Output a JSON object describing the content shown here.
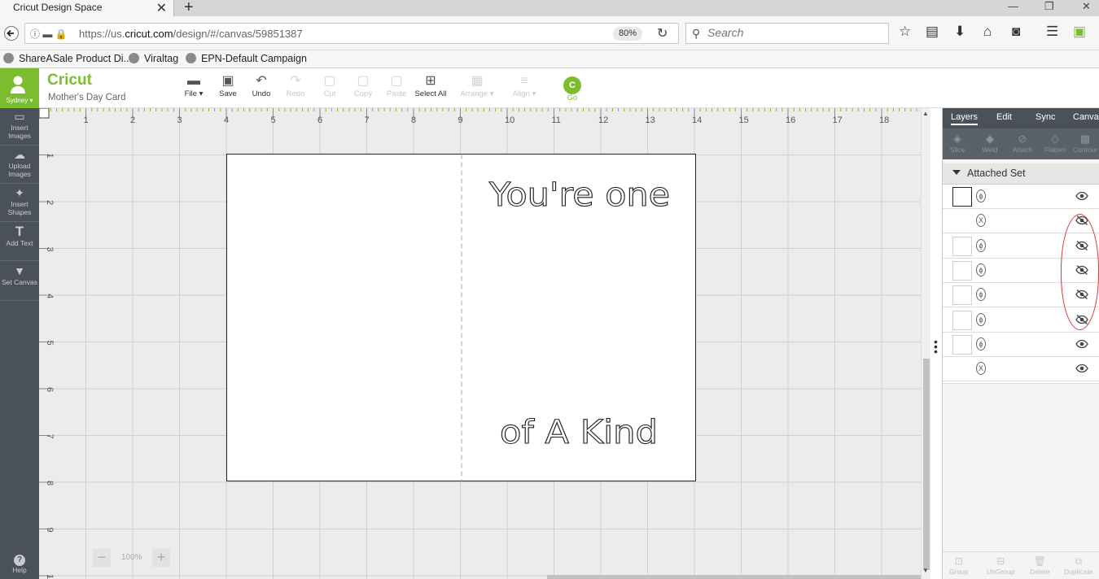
{
  "browser": {
    "tab_title": "Cricut Design Space",
    "tab_close": "✕",
    "new_tab": "+",
    "window_controls": [
      "—",
      "❐",
      "✕"
    ],
    "url_prefix": "https://us.",
    "url_host": "cricut.com",
    "url_path": "/design/#/canvas/59851387",
    "zoom": "80%",
    "search_placeholder": "Search",
    "bookmarks": [
      "ShareASale Product Di...",
      "Viraltag",
      "EPN-Default Campaign"
    ]
  },
  "app": {
    "logo": "Cricut",
    "project_name": "Mother's Day Card",
    "user_name": "Sydney ▾",
    "toolbar": [
      {
        "label": "File ▾",
        "icon": "folder-icon",
        "glyph": "▬",
        "enabled": true
      },
      {
        "label": "Save",
        "icon": "save-icon",
        "glyph": "▣",
        "enabled": true
      },
      {
        "label": "Undo",
        "icon": "undo-icon",
        "glyph": "↶",
        "enabled": true
      },
      {
        "label": "Redo",
        "icon": "redo-icon",
        "glyph": "↷",
        "enabled": false
      },
      {
        "label": "Cut",
        "icon": "cut-icon",
        "glyph": "▢",
        "enabled": false
      },
      {
        "label": "Copy",
        "icon": "copy-icon",
        "glyph": "▢",
        "enabled": false
      },
      {
        "label": "Paste",
        "icon": "paste-icon",
        "glyph": "▢",
        "enabled": false
      },
      {
        "label": "Select All",
        "icon": "select-all-icon",
        "glyph": "⊞",
        "enabled": true
      },
      {
        "label": "Arrange ▾",
        "icon": "arrange-icon",
        "glyph": "▦",
        "enabled": false
      },
      {
        "label": "Align ▾",
        "icon": "align-icon",
        "glyph": "≡",
        "enabled": false
      }
    ],
    "go_badge": "C",
    "go_label": "Go"
  },
  "sidebar": {
    "items": [
      {
        "label": "Insert Images",
        "icon": "image-icon",
        "glyph": "▭"
      },
      {
        "label": "Upload Images",
        "icon": "upload-cloud-icon",
        "glyph": "☁"
      },
      {
        "label": "Insert Shapes",
        "icon": "shapes-icon",
        "glyph": "✦"
      },
      {
        "label": "Add Text",
        "icon": "text-icon",
        "glyph": "T"
      },
      {
        "label": "Set Canvas",
        "icon": "shirt-icon",
        "glyph": "▼"
      }
    ],
    "help": "Help",
    "help_glyph": "?"
  },
  "canvas": {
    "ruler_h": [
      "1",
      "2",
      "3",
      "4",
      "5",
      "6",
      "7",
      "8",
      "9",
      "10",
      "11",
      "12",
      "13",
      "14",
      "15",
      "16",
      "17",
      "18"
    ],
    "ruler_v": [
      "1",
      "2",
      "3",
      "4",
      "5",
      "6",
      "7",
      "8",
      "9",
      "10"
    ],
    "card_text_top": "You're one",
    "card_text_bottom": "of A Kind",
    "zoom_minus": "−",
    "zoom_value": "100%",
    "zoom_plus": "+"
  },
  "panel": {
    "tabs": [
      "Layers",
      "Edit",
      "Sync",
      "Canvas"
    ],
    "active_tab": "Layers",
    "tools": [
      {
        "label": "Slice",
        "glyph": "◈"
      },
      {
        "label": "Weld",
        "glyph": "◆"
      },
      {
        "label": "Attach",
        "glyph": "⊘"
      },
      {
        "label": "Flatten",
        "glyph": "◇"
      },
      {
        "label": "Contour",
        "glyph": "▩"
      }
    ],
    "group_label": "Attached Set",
    "layers": [
      {
        "op": "cut",
        "op_glyph": "ϕ",
        "visible": true
      },
      {
        "op": "score",
        "op_glyph": "X",
        "visible": false
      },
      {
        "op": "cut",
        "op_glyph": "ϕ",
        "visible": false
      },
      {
        "op": "cut",
        "op_glyph": "ϕ",
        "visible": false
      },
      {
        "op": "cut",
        "op_glyph": "ϕ",
        "visible": false
      },
      {
        "op": "cut",
        "op_glyph": "ϕ",
        "visible": false
      },
      {
        "op": "cut",
        "op_glyph": "ϕ",
        "visible": true
      },
      {
        "op": "score",
        "op_glyph": "X",
        "visible": true
      }
    ],
    "bottom_tools": [
      {
        "label": "Group",
        "glyph": "⊡"
      },
      {
        "label": "UnGroup",
        "glyph": "⊟"
      },
      {
        "label": "Delete",
        "glyph": "🗑"
      },
      {
        "label": "Duplicate",
        "glyph": "⧉"
      }
    ]
  },
  "colors": {
    "brand_green": "#7cbd2f",
    "sidebar_gray": "#4a5159",
    "highlight_red": "#d33333"
  }
}
